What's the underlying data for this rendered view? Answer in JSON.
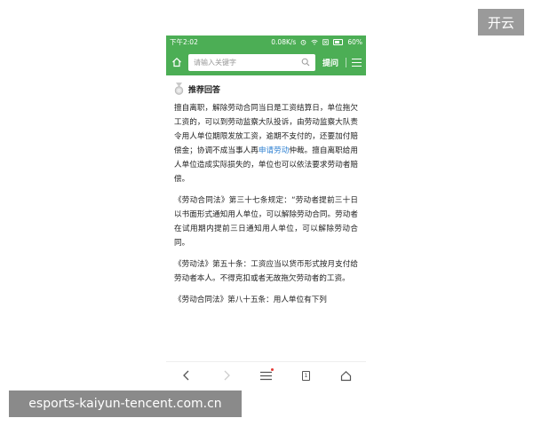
{
  "corner_badge": "开云",
  "status_bar": {
    "time": "下午2:02",
    "speed": "0.08K/s",
    "battery": "60%"
  },
  "search": {
    "placeholder": "请输入关键字",
    "ask_label": "提问"
  },
  "answer": {
    "header": "推荐回答",
    "paragraphs": [
      {
        "before": "擅自离职，解除劳动合同当日是工资结算日，单位拖欠工资的，可以到劳动监察大队投诉，由劳动监察大队责令用人单位期限发放工资，逾期不支付的，还要加付赔偿金；协调不成当事人再",
        "link": "申请劳动",
        "after": "仲裁。擅自离职给用人单位造成实际损失的，单位也可以依法要求劳动者赔偿。"
      },
      {
        "text": "《劳动合同法》第三十七条规定：“劳动者提前三十日以书面形式通知用人单位，可以解除劳动合同。劳动者在试用期内提前三日通知用人单位，可以解除劳动合同。"
      },
      {
        "text": "《劳动法》第五十条：工资应当以货币形式按月支付给劳动者本人。不得克扣或者无故拖欠劳动者的工资。"
      },
      {
        "text": "《劳动合同法》第八十五条：用人单位有下列"
      }
    ]
  },
  "bottom_nav": {
    "tab_count": "1"
  },
  "watermark": "esports-kaiyun-tencent.com.cn",
  "colors": {
    "brand_green": "#4cae55",
    "link_blue": "#2c7fd1"
  }
}
